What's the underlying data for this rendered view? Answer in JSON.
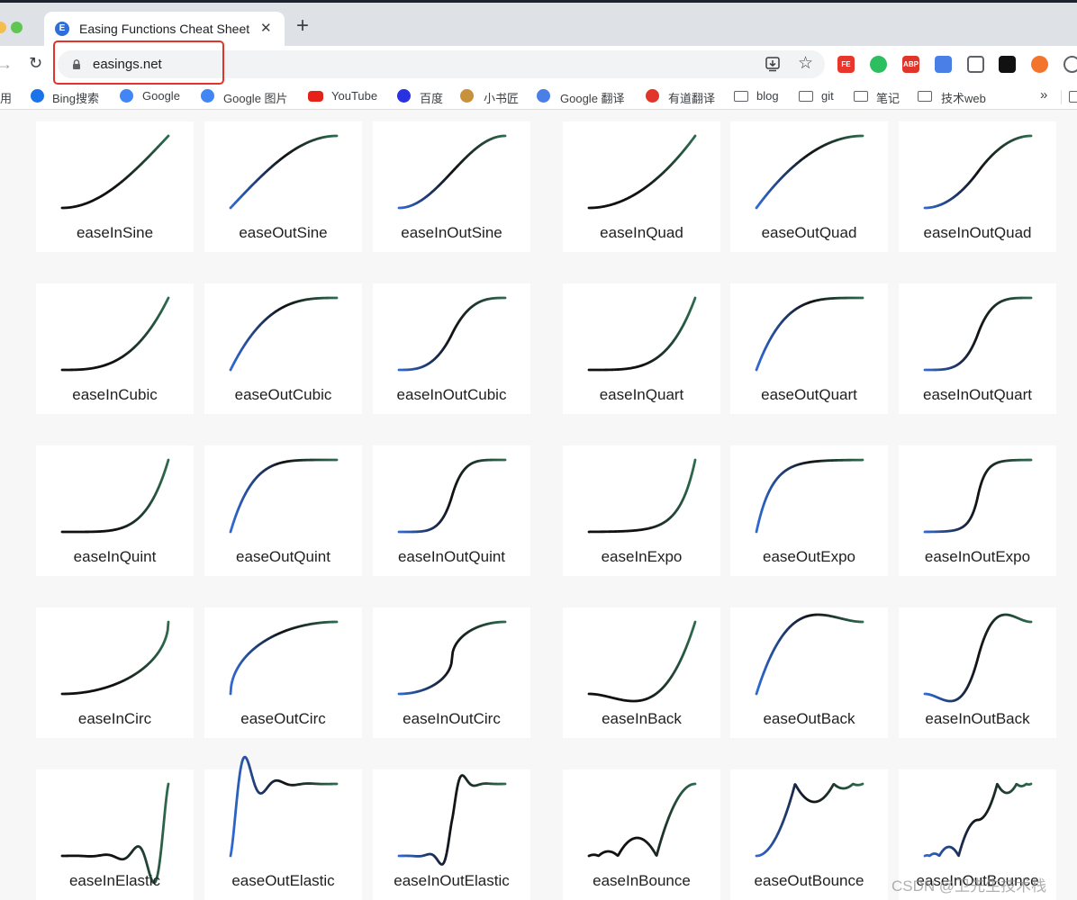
{
  "browser": {
    "tab": {
      "favicon_letter": "E",
      "title": "Easing Functions Cheat Sheet",
      "close_symbol": "✕"
    },
    "new_tab_symbol": "+",
    "url": "easings.net",
    "extensions": [
      {
        "name": "fe-extension-icon",
        "label": "FE",
        "color": "#e8362d"
      },
      {
        "name": "evernote-icon",
        "label": "",
        "color": "#2dbe60"
      },
      {
        "name": "adblock-icon",
        "label": "ABP",
        "color": "#e0352b"
      },
      {
        "name": "translate-extension-icon",
        "label": "",
        "color": "#4a7fe8"
      },
      {
        "name": "tv-extension-icon",
        "label": "",
        "color": "#5f6368"
      },
      {
        "name": "dual-window-icon",
        "label": "",
        "color": "#111111"
      },
      {
        "name": "lifebuoy-icon",
        "label": "",
        "color": "#f2742d"
      },
      {
        "name": "puzzle-icon",
        "label": "",
        "color": "#5f6368"
      }
    ],
    "bookmarks": [
      {
        "name": "apps",
        "label": "用",
        "icon": "none"
      },
      {
        "name": "bing",
        "label": "Bing搜索",
        "icon": "bing-icon"
      },
      {
        "name": "google",
        "label": "Google",
        "icon": "google-icon"
      },
      {
        "name": "google-images",
        "label": "Google 图片",
        "icon": "google-icon"
      },
      {
        "name": "youtube",
        "label": "YouTube",
        "icon": "youtube-icon"
      },
      {
        "name": "baidu",
        "label": "百度",
        "icon": "baidu-icon"
      },
      {
        "name": "xiaoshujiang",
        "label": "小书匠",
        "icon": "xiaoshujiang-icon"
      },
      {
        "name": "google-translate",
        "label": "Google 翻译",
        "icon": "translate-icon"
      },
      {
        "name": "youdao",
        "label": "有道翻译",
        "icon": "youdao-icon"
      },
      {
        "name": "blog",
        "label": "blog",
        "icon": "folder-icon"
      },
      {
        "name": "git",
        "label": "git",
        "icon": "folder-icon"
      },
      {
        "name": "notes",
        "label": "笔记",
        "icon": "folder-icon"
      },
      {
        "name": "tech-web",
        "label": "技术web",
        "icon": "folder-icon"
      }
    ],
    "bookmarks_more": "»"
  },
  "easings": [
    [
      "easeInSine",
      "easeOutSine",
      "easeInOutSine",
      "easeInQuad",
      "easeOutQuad",
      "easeInOutQuad"
    ],
    [
      "easeInCubic",
      "easeOutCubic",
      "easeInOutCubic",
      "easeInQuart",
      "easeOutQuart",
      "easeInOutQuart"
    ],
    [
      "easeInQuint",
      "easeOutQuint",
      "easeInOutQuint",
      "easeInExpo",
      "easeOutExpo",
      "easeInOutExpo"
    ],
    [
      "easeInCirc",
      "easeOutCirc",
      "easeInOutCirc",
      "easeInBack",
      "easeOutBack",
      "easeInOutBack"
    ],
    [
      "easeInElastic",
      "easeOutElastic",
      "easeInOutElastic",
      "easeInBounce",
      "easeOutBounce",
      "easeInOutBounce"
    ]
  ],
  "colors": {
    "curve_start": "#2f6ad6",
    "curve_mid": "#111111",
    "curve_end": "#2e6b4f",
    "card_bg": "#ffffff",
    "page_bg": "#f7f7f7",
    "highlight": "#e0352b"
  },
  "watermark": "CSDN @卫先生技术栈"
}
